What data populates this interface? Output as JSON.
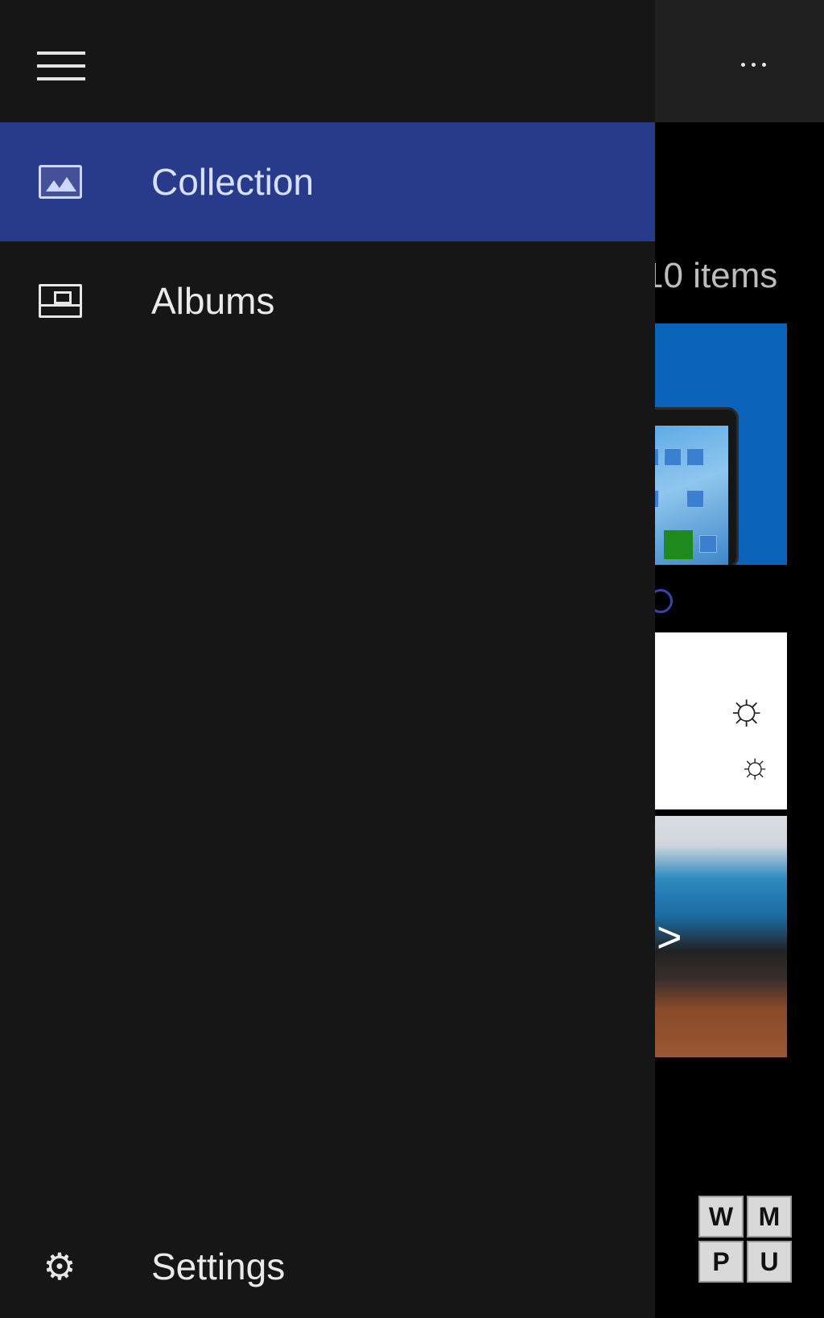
{
  "header": {
    "menu_icon": "hamburger-icon",
    "more_icon": "more-options-icon"
  },
  "drawer": {
    "items": [
      {
        "label": "Collection",
        "icon": "collection-icon",
        "selected": true
      },
      {
        "label": "Albums",
        "icon": "albums-icon",
        "selected": false
      }
    ],
    "settings": {
      "label": "Settings",
      "icon": "gear-icon"
    }
  },
  "content": {
    "items_count": "10 items"
  },
  "watermark": {
    "letters": [
      "W",
      "M",
      "P",
      "U"
    ]
  },
  "colors": {
    "accent": "#283a8a",
    "drawer_bg": "#161616",
    "header_bg": "#1f1f1f"
  }
}
